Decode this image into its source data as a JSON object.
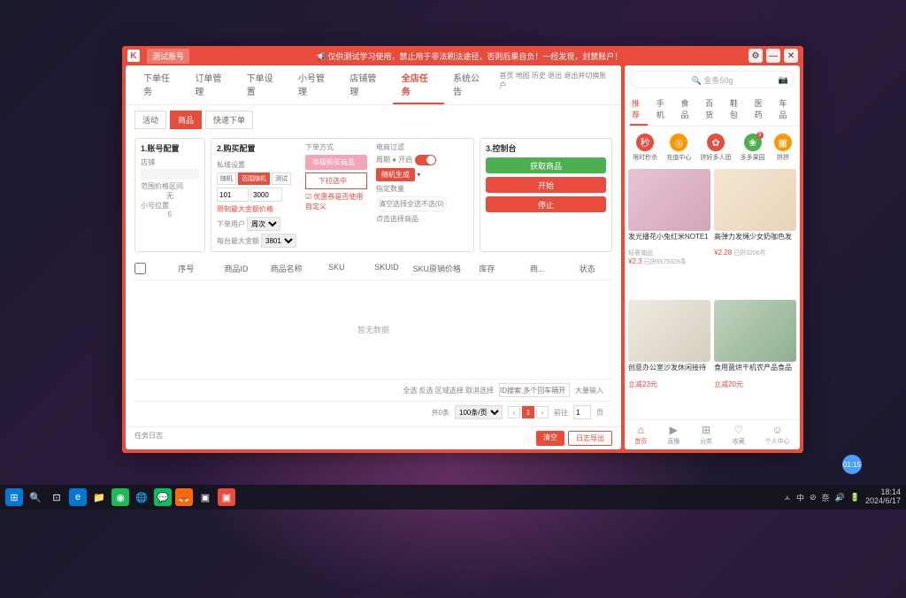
{
  "taskbar": {
    "time": "18:14",
    "date": "2024/6/17",
    "tray": [
      "ㅅ",
      "中",
      "⊘",
      "奈",
      "🔊",
      "🔋"
    ],
    "badge": "01:15"
  },
  "titlebar": {
    "logo": "K",
    "tab": "测试账号",
    "notice": "📢 仅供测试学习使用，禁止用于非法刷法途径，否则后果自负！一经发现，封禁账户！"
  },
  "mainTabs": [
    "下单任务",
    "订单管理",
    "下单设置",
    "小号管理",
    "店铺管理",
    "全店任务",
    "系统公告"
  ],
  "mainTabActive": 5,
  "topLinks": "首页 地图 历史 退出 退出并切换账户",
  "subTabs": [
    "活动",
    "商品",
    "快速下单"
  ],
  "subTabActive": 1,
  "config": {
    "sec1": {
      "hdr": "1.账号配置",
      "l1": "店铺",
      "l2": "范围价格区间",
      "v2": "无",
      "l3": "小号位置",
      "v3": "5"
    },
    "sec2": {
      "hdr": "2.购买配置",
      "modeLabel": "私域设置",
      "modeOpts": [
        "随机",
        "范围随机",
        "测试"
      ],
      "r1a": "101",
      "r1b": "3000",
      "limitLabel": "限制最大金额价格",
      "limitVal": "3801",
      "downLabel": "下单方式",
      "downBtn": "等级购买商品",
      "submitBtn": "下拉选中",
      "ckLabel": "☑ 优惠券是否使用自定义",
      "perLabel": "下单用户",
      "perSel": "周次",
      "priceLabel": "每台最大金额",
      "priceVal": "3801",
      "filterLabel": "电商过滤",
      "filterToggle": "周期 ● 开启",
      "genBtn": "随机生成",
      "fixLabel": "指定数量",
      "extraLabel": "清空选择全选不选(0)",
      "linkLabel": "点击选择商品"
    },
    "sec3": {
      "hdr": "3.控制台",
      "btns": [
        "获取商品",
        "开始",
        "停止"
      ]
    }
  },
  "table": {
    "cols": [
      "序号",
      "商品ID",
      "商品名称",
      "SKU",
      "SKUID",
      "SKU原销价格",
      "库存",
      "商...",
      "状态"
    ],
    "empty": "暂无数据",
    "footerLinks": "全选 反选 区域选择 取消选择",
    "footerPlaceholder": "ID搜索,多个回车隔开",
    "footerBtn": "大量输入",
    "totalLabel": "共0条",
    "perPage": "100条/页",
    "page": "1",
    "goLabel": "前往",
    "goPage": "1",
    "goSuffix": "页"
  },
  "log": {
    "label": "任务日志",
    "b1": "清空",
    "b2": "日志导出"
  },
  "shop": {
    "searchPlaceholder": "🔍 金条50g",
    "cats": [
      "推荐",
      "手机",
      "食品",
      "百货",
      "鞋包",
      "医药",
      "车品"
    ],
    "quick": [
      {
        "icon": "秒",
        "bg": "#e84c3d",
        "label": "限时秒杀",
        "dot": ""
      },
      {
        "icon": "◎",
        "bg": "#ff9800",
        "label": "充值中心",
        "dot": ""
      },
      {
        "icon": "✿",
        "bg": "#e84c3d",
        "label": "拼好多人团",
        "dot": ""
      },
      {
        "icon": "❀",
        "bg": "#4caf50",
        "label": "多多果园",
        "dot": "3"
      },
      {
        "icon": "▦",
        "bg": "#ff9800",
        "label": "拼拼",
        "dot": ""
      }
    ],
    "products": [
      {
        "title": "发光播花小兔红米NOTE1",
        "sub": "轻奢潮品",
        "price": "¥2.3",
        "sold": "已拼6579328条"
      },
      {
        "title": "高弹力发绳少女奶咖色发",
        "sub": "",
        "price": "¥2.28",
        "sold": "已拼3206件"
      },
      {
        "title": "创意办公室沙发休闲接待",
        "sub": "",
        "price": "立减23元",
        "sold": ""
      },
      {
        "title": "食用菌烘干机农产品食品",
        "sub": "",
        "price": "立减20元",
        "sold": ""
      }
    ],
    "nav": [
      {
        "icon": "⌂",
        "label": "首页",
        "active": true
      },
      {
        "icon": "▶",
        "label": "直播"
      },
      {
        "icon": "⊞",
        "label": "分类"
      },
      {
        "icon": "♡",
        "label": "收藏"
      },
      {
        "icon": "☺",
        "label": "个人中心"
      }
    ]
  }
}
